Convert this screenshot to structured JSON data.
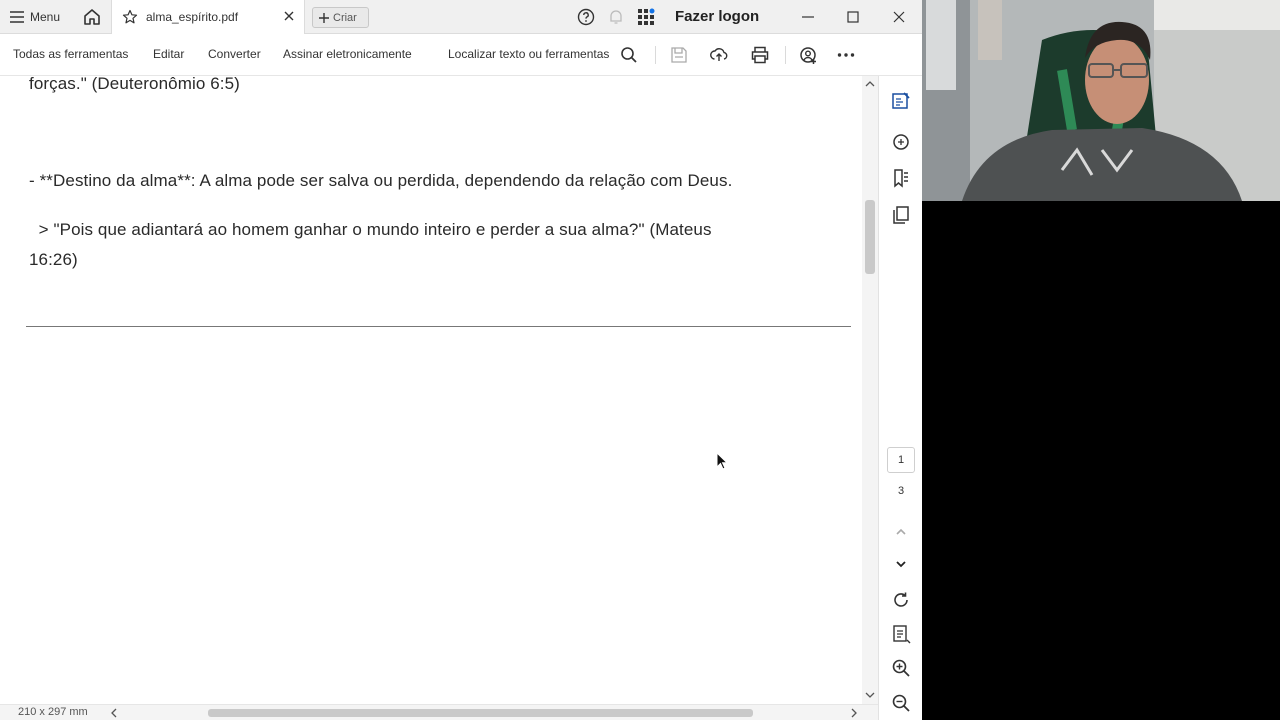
{
  "titlebar": {
    "menu_label": "Menu",
    "tab_label": "alma_espírito.pdf",
    "create_label": "Criar",
    "logon_label": "Fazer logon"
  },
  "toolbar": {
    "all_tools": "Todas as ferramentas",
    "edit": "Editar",
    "convert": "Converter",
    "sign": "Assinar eletronicamente",
    "find": "Localizar texto ou ferramentas"
  },
  "document": {
    "line1": "forças.\" (Deuteronômio 6:5)",
    "line2": "- **Destino da alma**: A alma pode ser salva ou perdida, dependendo da relação com Deus.",
    "line3": "  > \"Pois que adiantará ao homem ganhar o mundo inteiro e perder a sua alma?\" (Mateus",
    "line4": "16:26)"
  },
  "status": {
    "page_size": "210 x 297 mm",
    "current_page": "1",
    "total_pages": "3"
  },
  "colors": {
    "accent": "#1473e6",
    "titlebar_bg": "#f0f0f0"
  },
  "icons": [
    "hamburger-icon",
    "home-icon",
    "star-icon",
    "close-icon",
    "plus-icon",
    "help-icon",
    "bell-icon",
    "apps-grid-icon",
    "minimize-icon",
    "maximize-icon",
    "search-icon",
    "save-icon",
    "upload-icon",
    "print-icon",
    "share-icon",
    "more-icon",
    "edit-pdf-icon",
    "comment-icon",
    "bookmark-icon",
    "pages-icon",
    "chevron-up-icon",
    "chevron-down-icon",
    "rotate-icon",
    "page-fit-icon",
    "zoom-in-icon",
    "zoom-out-icon"
  ]
}
